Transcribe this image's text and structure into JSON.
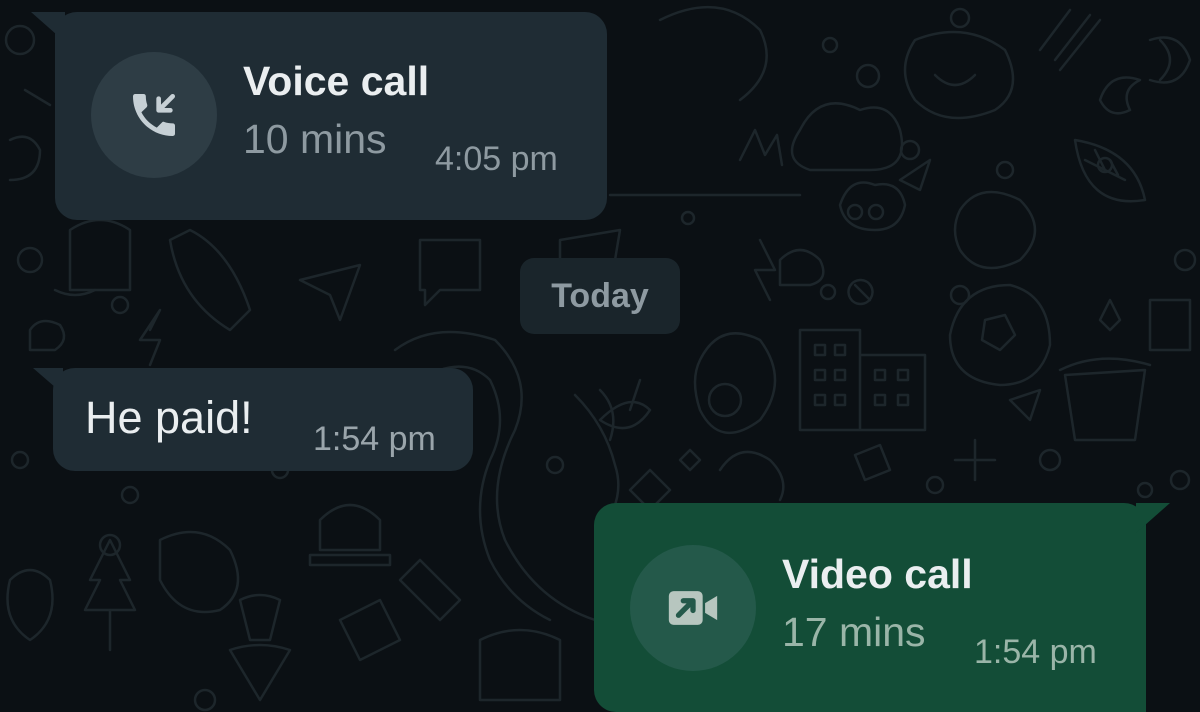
{
  "chat": {
    "messages": [
      {
        "direction": "incoming",
        "type": "call",
        "call_icon": "incoming-voice-call-icon",
        "title": "Voice call",
        "duration": "10 mins",
        "time": "4:05 pm"
      },
      {
        "type": "date-separator",
        "label": "Today"
      },
      {
        "direction": "incoming",
        "type": "text",
        "text": "He paid!",
        "time": "1:54 pm"
      },
      {
        "direction": "outgoing",
        "type": "call",
        "call_icon": "outgoing-video-call-icon",
        "title": "Video call",
        "duration": "17 mins",
        "time": "1:54 pm"
      }
    ]
  },
  "colors": {
    "background": "#0b1014",
    "incoming_bubble": "#1f2c34",
    "outgoing_bubble": "#134d37",
    "primary_text": "#eaeef0",
    "secondary_text": "#8e9aa1"
  }
}
